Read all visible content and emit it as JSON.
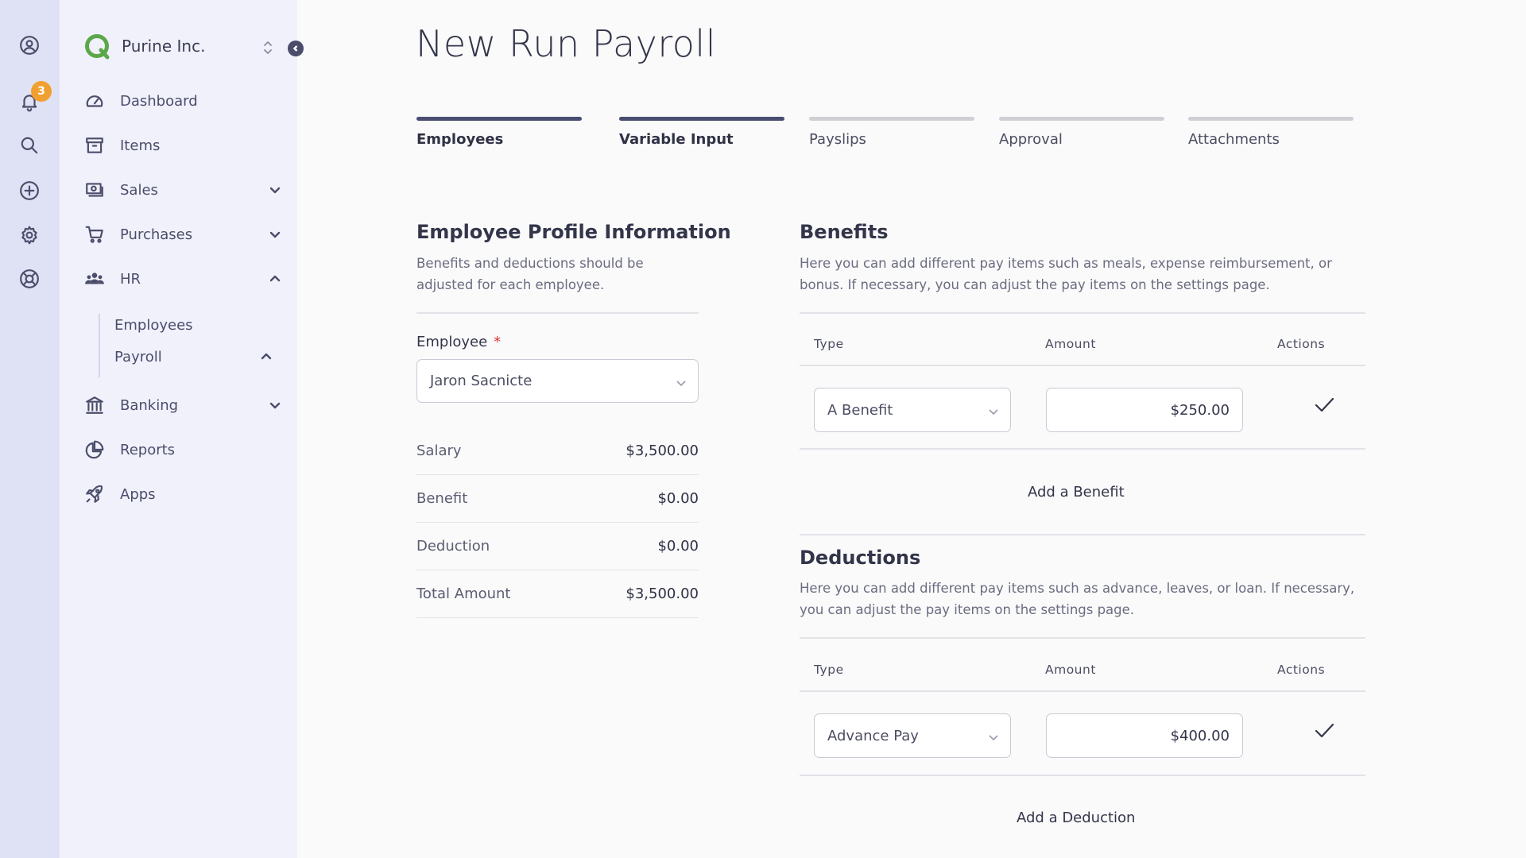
{
  "rail": {
    "notifications_count": "3",
    "icons": [
      "user-circle-icon",
      "bell-icon",
      "search-icon",
      "plus-circle-icon",
      "gear-icon",
      "lifebuoy-icon"
    ]
  },
  "company": {
    "name": "Purine Inc."
  },
  "nav": {
    "dashboard": "Dashboard",
    "items": "Items",
    "sales": "Sales",
    "purchases": "Purchases",
    "hr": "HR",
    "hr_sub": {
      "employees": "Employees",
      "payroll": "Payroll"
    },
    "banking": "Banking",
    "reports": "Reports",
    "apps": "Apps"
  },
  "page": {
    "title": "New Run Payroll"
  },
  "steps": [
    {
      "label": "Employees",
      "state": "completed"
    },
    {
      "label": "Variable Input",
      "state": "active"
    },
    {
      "label": "Payslips",
      "state": "pending"
    },
    {
      "label": "Approval",
      "state": "pending"
    },
    {
      "label": "Attachments",
      "state": "pending"
    }
  ],
  "profile": {
    "title": "Employee Profile Information",
    "description": "Benefits and deductions should be adjusted for each employee.",
    "employee_label": "Employee",
    "required_mark": "*",
    "employee_value": "Jaron Sacnicte",
    "summary": [
      {
        "label": "Salary",
        "value": "$3,500.00"
      },
      {
        "label": "Benefit",
        "value": "$0.00"
      },
      {
        "label": "Deduction",
        "value": "$0.00"
      },
      {
        "label": "Total Amount",
        "value": "$3,500.00"
      }
    ]
  },
  "benefits": {
    "title": "Benefits",
    "description": "Here you can add different pay items such as meals, expense reimbursement, or bonus. If necessary, you can adjust the pay items on the settings page.",
    "columns": {
      "type": "Type",
      "amount": "Amount",
      "actions": "Actions"
    },
    "row": {
      "type": "A Benefit",
      "amount": "$250.00"
    },
    "add_label": "Add a Benefit"
  },
  "deductions": {
    "title": "Deductions",
    "description": "Here you can add different pay items such as advance, leaves, or loan. If necessary, you can adjust the pay items on the settings page.",
    "columns": {
      "type": "Type",
      "amount": "Amount",
      "actions": "Actions"
    },
    "row": {
      "type": "Advance Pay",
      "amount": "$400.00"
    },
    "add_label": "Add a Deduction"
  },
  "colors": {
    "accent": "#4a4c70",
    "rail_bg": "#dfe1f4",
    "sidebar_bg": "#f0f1fa",
    "badge": "#f0a030",
    "logo_green": "#5aa84a"
  }
}
